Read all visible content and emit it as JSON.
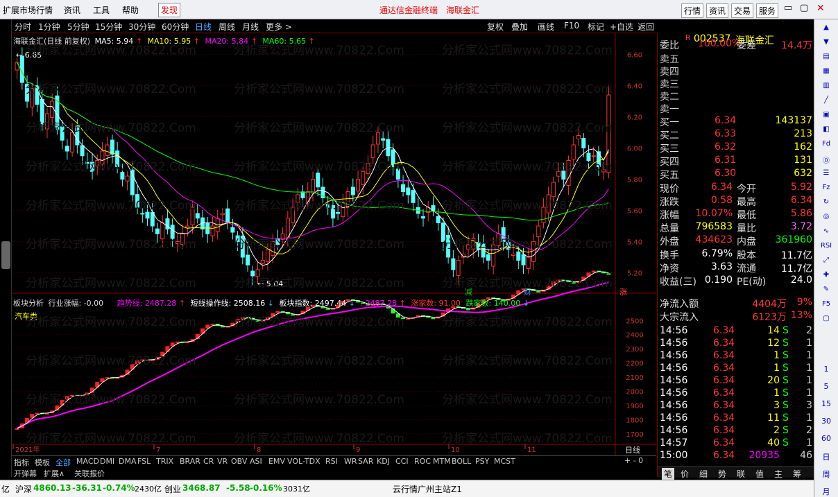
{
  "menubar": {
    "items": [
      "扩展市场行情",
      "资讯",
      "工具",
      "帮助",
      "发现"
    ],
    "center_title": "通达信金融终端",
    "center_stock": "海联金汇",
    "right_items": [
      "行情",
      "资讯",
      "交易",
      "服务"
    ]
  },
  "toolbar": {
    "periods": [
      "分时",
      "1分钟",
      "5分钟",
      "15分钟",
      "30分钟",
      "60分钟",
      "日线",
      "周线",
      "月线",
      "更多 >"
    ],
    "actions": [
      "复权",
      "叠加",
      "画线",
      "F10",
      "标记",
      "+自选",
      "返回"
    ]
  },
  "chart_data": {
    "type": "candlestick",
    "title": "海联金汇(日线 前复权)",
    "ma_labels": [
      {
        "label": "MA5: 5.94",
        "color": "#ffffff"
      },
      {
        "label": "MA10: 5.95",
        "color": "#ffff00"
      },
      {
        "label": "MA20: 5.84",
        "color": "#ff00ff"
      },
      {
        "label": "MA60: 5.65",
        "color": "#00ff00"
      }
    ],
    "y_ticks": [
      "6.60",
      "6.40",
      "6.20",
      "6.00",
      "5.80",
      "5.60",
      "5.40",
      "5.20"
    ],
    "ylim": [
      5.1,
      6.7
    ],
    "high_label": "6.65",
    "low_label": "5.04",
    "month_labels": [
      "2021年",
      "7",
      "8",
      "9",
      "10",
      "11"
    ],
    "event_marks": [
      "减",
      "财",
      "涨"
    ],
    "period_label": "日线",
    "sub_chart": {
      "title": "板块分析",
      "indicators": [
        {
          "label": "行业涨幅: -0.00",
          "color": "#dddddd"
        },
        {
          "label": "趋势线: 2487.28",
          "color": "#ff00ff"
        },
        {
          "label": "短线操作线: 2508.16",
          "color": "#ffffff"
        },
        {
          "label": "板块指数: 2497.44",
          "color": "#ffffff"
        },
        {
          "label": ": 2487.28",
          "color": "#ff00ff"
        },
        {
          "label": "涨家数: 91.00",
          "color": "#ff0000"
        },
        {
          "label": "跌家数: 140.00",
          "color": "#00ff00"
        }
      ],
      "sector": "汽车类",
      "y_ticks": [
        "2500",
        "2400",
        "2300",
        "2200",
        "2100",
        "2000",
        "1900",
        "1800",
        "1700"
      ],
      "ylim": [
        1650,
        2570
      ]
    }
  },
  "quote": {
    "code": "002537",
    "name": "海联金汇",
    "weibi_label": "委比",
    "weibi": "100.00%",
    "weicha_label": "委差",
    "weicha": "14.4万",
    "asks": [
      {
        "label": "卖五",
        "price": "",
        "vol": ""
      },
      {
        "label": "卖四",
        "price": "",
        "vol": ""
      },
      {
        "label": "卖三",
        "price": "",
        "vol": ""
      },
      {
        "label": "卖二",
        "price": "",
        "vol": ""
      },
      {
        "label": "卖一",
        "price": "",
        "vol": ""
      }
    ],
    "bids": [
      {
        "label": "买一",
        "price": "6.34",
        "vol": "143137"
      },
      {
        "label": "买二",
        "price": "6.33",
        "vol": "213"
      },
      {
        "label": "买三",
        "price": "6.32",
        "vol": "162"
      },
      {
        "label": "买四",
        "price": "6.31",
        "vol": "131"
      },
      {
        "label": "买五",
        "price": "6.30",
        "vol": "632"
      }
    ],
    "stats": [
      {
        "l1": "现价",
        "v1": "6.34",
        "c1": "#ff3333",
        "l2": "今开",
        "v2": "5.92",
        "c2": "#ff3333"
      },
      {
        "l1": "涨跌",
        "v1": "0.58",
        "c1": "#ff3333",
        "l2": "最高",
        "v2": "6.34",
        "c2": "#ff3333"
      },
      {
        "l1": "涨幅",
        "v1": "10.07%",
        "c1": "#ff3333",
        "l2": "最低",
        "v2": "5.86",
        "c2": "#ff3333"
      },
      {
        "l1": "总量",
        "v1": "796583",
        "c1": "#ffff00",
        "l2": "量比",
        "v2": "3.72",
        "c2": "#ff66ff"
      },
      {
        "l1": "外盘",
        "v1": "434623",
        "c1": "#ff3333",
        "l2": "内盘",
        "v2": "361960",
        "c2": "#00ff00"
      }
    ],
    "fin": [
      {
        "l1": "换手",
        "v1": "6.79%",
        "l2": "股本",
        "v2": "11.7亿"
      },
      {
        "l1": "净资",
        "v1": "3.63",
        "l2": "流通",
        "v2": "11.7亿"
      },
      {
        "l1": "收益(三)",
        "v1": "0.190",
        "l2": "PE(动)",
        "v2": "24.0"
      }
    ],
    "flows": [
      {
        "label": "净流入额",
        "v": "4404万",
        "p": "9%"
      },
      {
        "label": "大宗流入",
        "v": "6123万",
        "p": "13%"
      }
    ],
    "ticks": [
      {
        "t": "14:56",
        "p": "6.34",
        "v": "14",
        "s": "S",
        "n": "2"
      },
      {
        "t": "14:56",
        "p": "6.34",
        "v": "12",
        "s": "S",
        "n": "1"
      },
      {
        "t": "14:56",
        "p": "6.34",
        "v": "1",
        "s": "S",
        "n": "1"
      },
      {
        "t": "14:56",
        "p": "6.34",
        "v": "1",
        "s": "S",
        "n": "1"
      },
      {
        "t": "14:56",
        "p": "6.34",
        "v": "20",
        "s": "S",
        "n": "1"
      },
      {
        "t": "14:56",
        "p": "6.34",
        "v": "1",
        "s": "S",
        "n": "1"
      },
      {
        "t": "14:56",
        "p": "6.34",
        "v": "3",
        "s": "S",
        "n": "3"
      },
      {
        "t": "14:56",
        "p": "6.34",
        "v": "11",
        "s": "S",
        "n": "1"
      },
      {
        "t": "14:56",
        "p": "6.34",
        "v": "2",
        "s": "S",
        "n": "2"
      },
      {
        "t": "14:57",
        "p": "6.34",
        "v": "40",
        "s": "S",
        "n": "1"
      },
      {
        "t": "15:00",
        "p": "6.34",
        "v": "20935",
        "s": "",
        "n": "46"
      }
    ],
    "bottom_tabs": [
      "笔",
      "价",
      "细",
      "势",
      "联",
      "值",
      "主",
      "筹"
    ]
  },
  "bottom_tabs": [
    "指标",
    "模板",
    "全部",
    "MACD",
    "DMI",
    "DMA",
    "FSL",
    "TRIX",
    "BRAR",
    "CR",
    "VR",
    "OBV",
    "ASI",
    "EMV",
    "VOL-TDX",
    "RSI",
    "WR",
    "SAR",
    "KDJ",
    "CCI",
    "ROC",
    "MTM",
    "BOLL",
    "PSY",
    "MCST"
  ],
  "sub_tabs": [
    "开弹幕",
    "扩展∧",
    "关联报价"
  ],
  "right_sidebar": [
    "1",
    "5",
    "15",
    "30",
    "60",
    "日",
    "周",
    "月"
  ],
  "status": {
    "left": "亿",
    "index1_name": "沪深",
    "index1_val": "4860.13",
    "index1_chg": "-36.31",
    "index1_pct": "-0.74%",
    "index1_amt": "2430亿",
    "index2_name": "创业",
    "index2_val": "3468.87",
    "index2_chg": "-5.58",
    "index2_pct": "-0.16%",
    "index2_amt": "3031亿",
    "server": "云行情广州主站Z1"
  },
  "watermark": "分析家公式网www.70822.Com"
}
